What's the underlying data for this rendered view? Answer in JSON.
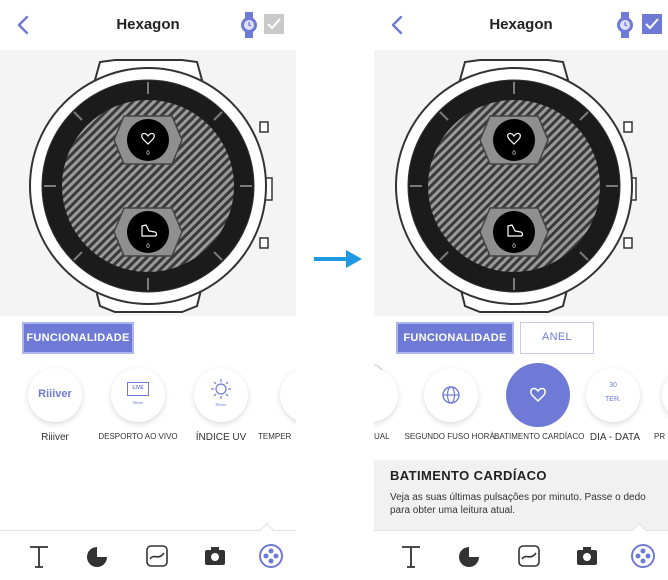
{
  "left": {
    "title": "Hexagon",
    "tabs": [
      "FUNCIONALIDADE"
    ],
    "items": [
      {
        "label": "Riiiver",
        "badge": "Riiiver"
      },
      {
        "label": "DESPORTO AO VIVO",
        "badge": "LIVE",
        "sub": "Riiiver"
      },
      {
        "label": "ÍNDICE UV",
        "badge": "UV",
        "sub": "Riiiver"
      },
      {
        "label": "TEMPER",
        "badge": ""
      }
    ],
    "subdials": [
      {
        "icon": "heart-icon",
        "value": "0"
      },
      {
        "icon": "shoe-icon",
        "value": "0"
      }
    ]
  },
  "right": {
    "title": "Hexagon",
    "tabs": [
      "FUNCIONALIDADE",
      "ANEL"
    ],
    "items": [
      {
        "label": "UAL"
      },
      {
        "label": "SEGUNDO FUSO HORÁ..."
      },
      {
        "label": "BATIMENTO CARDÍACO"
      },
      {
        "label": "DIA - DATA",
        "date_num": "30",
        "date_day": "TER."
      },
      {
        "label": "PR"
      }
    ],
    "subdials": [
      {
        "icon": "heart-icon",
        "value": "0"
      },
      {
        "icon": "shoe-icon",
        "value": "0"
      }
    ],
    "description": {
      "title": "BATIMENTO CARDÍACO",
      "text": "Veja as suas últimas pulsações por minuto. Passe o dedo para obter uma leitura atual."
    }
  },
  "colors": {
    "accent": "#6e7ad6",
    "arrow": "#1f9ae0"
  }
}
